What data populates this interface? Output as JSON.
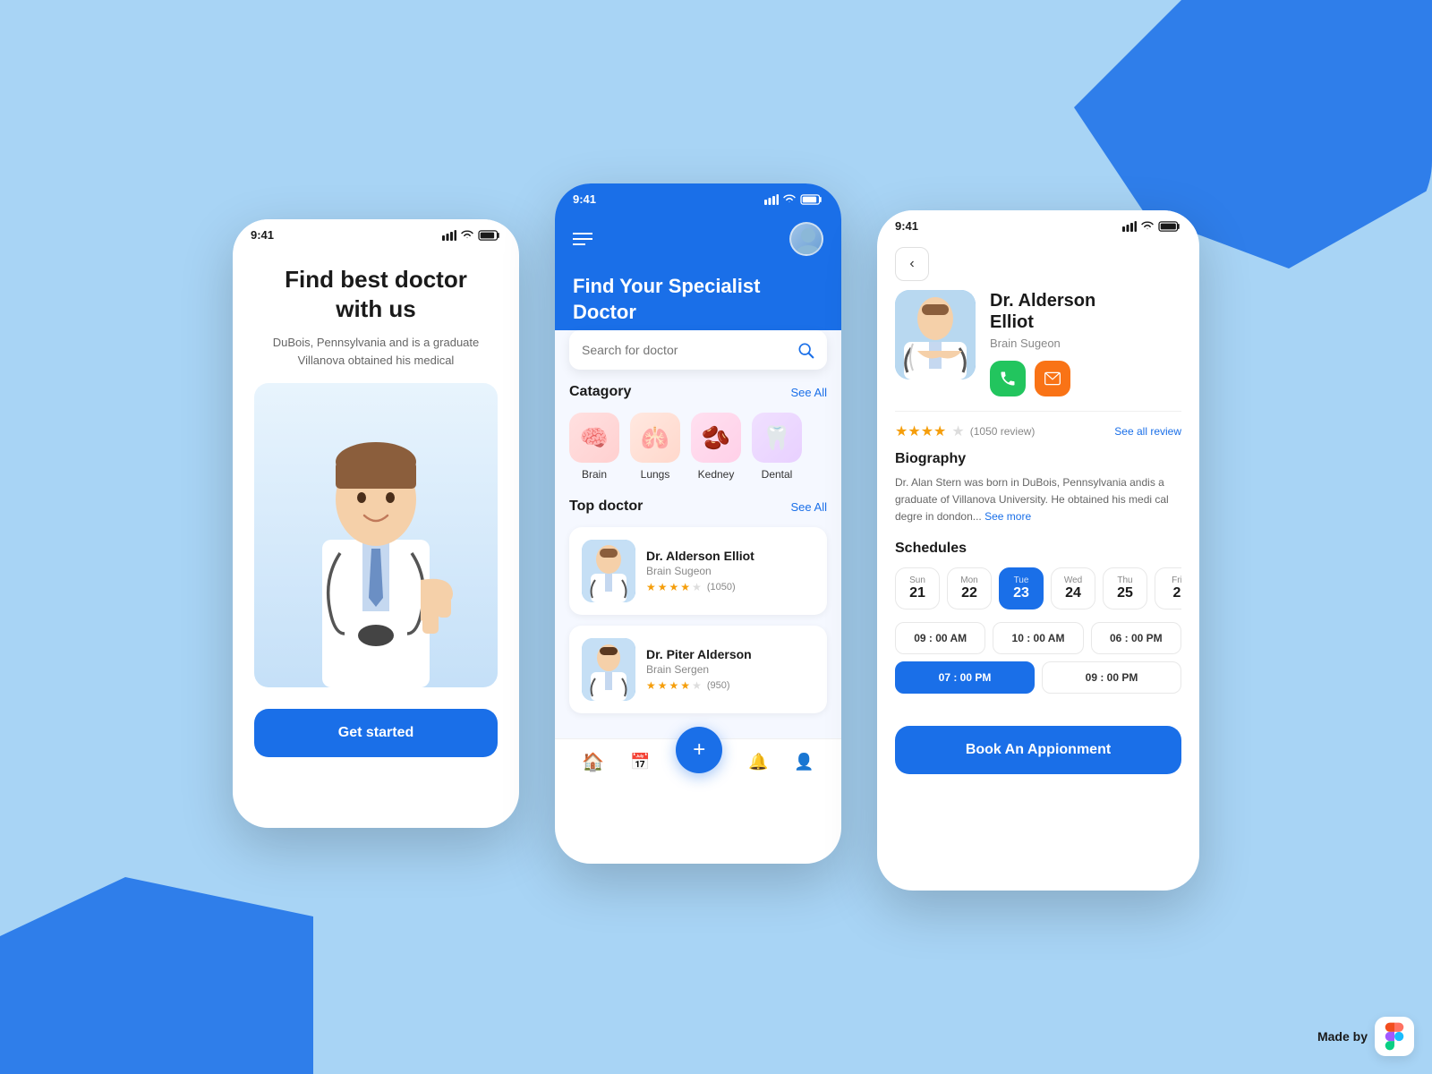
{
  "background": {
    "color": "#a8d4f5"
  },
  "phone1": {
    "status_time": "9:41",
    "title": "Find best doctor\nwith us",
    "subtitle": "DuBois, Pennsylvania and is a graduate Villanova obtained his medical",
    "cta_label": "Get started"
  },
  "phone2": {
    "status_time": "9:41",
    "header_title": "Find Your Specialist\nDoctor",
    "search_placeholder": "Search for doctor",
    "category_section": "Catagory",
    "category_see_all": "See All",
    "categories": [
      {
        "label": "Brain",
        "emoji": "🧠"
      },
      {
        "label": "Lungs",
        "emoji": "🫁"
      },
      {
        "label": "Kedney",
        "emoji": "🫘"
      },
      {
        "label": "Dental",
        "emoji": "🦷"
      }
    ],
    "top_doctor_section": "Top doctor",
    "top_doctor_see_all": "See All",
    "doctors": [
      {
        "name": "Dr. Alderson Elliot",
        "specialty": "Brain Sugeon",
        "rating": "★★★★☆",
        "reviews": "(1050)"
      },
      {
        "name": "Dr. Piter Alderson",
        "specialty": "Brain Sergen",
        "rating": "★★★★☆",
        "reviews": "(950)"
      }
    ],
    "nav_plus": "+"
  },
  "phone3": {
    "status_time": "9:41",
    "doctor_name": "Dr. Alderson\nElliot",
    "doctor_specialty": "Brain Sugeon",
    "rating_stars": "★★★★☆",
    "rating_count": "(1050 review)",
    "see_all_review": "See all review",
    "biography_title": "Biography",
    "biography_text": "Dr. Alan Stern was born in DuBois, Pennsylvania andis a graduate of Villanova University. He obtained his medi cal degre in dondon...",
    "see_more": "See more",
    "schedules_title": "Schedules",
    "dates": [
      {
        "day": "Sun",
        "num": "21",
        "active": false
      },
      {
        "day": "Mon",
        "num": "22",
        "active": false
      },
      {
        "day": "Tue",
        "num": "23",
        "active": true
      },
      {
        "day": "Wed",
        "num": "24",
        "active": false
      },
      {
        "day": "Thu",
        "num": "25",
        "active": false
      },
      {
        "day": "Fri",
        "num": "2",
        "active": false
      }
    ],
    "times": [
      {
        "label": "09 : 00 AM",
        "active": false
      },
      {
        "label": "10 : 00 AM",
        "active": false
      },
      {
        "label": "06 : 00 PM",
        "active": false
      },
      {
        "label": "07 : 00 PM",
        "active": true
      },
      {
        "label": "09 : 00 PM",
        "active": false
      }
    ],
    "book_btn": "Book An Appionment"
  },
  "made_by": {
    "label": "Made by"
  }
}
